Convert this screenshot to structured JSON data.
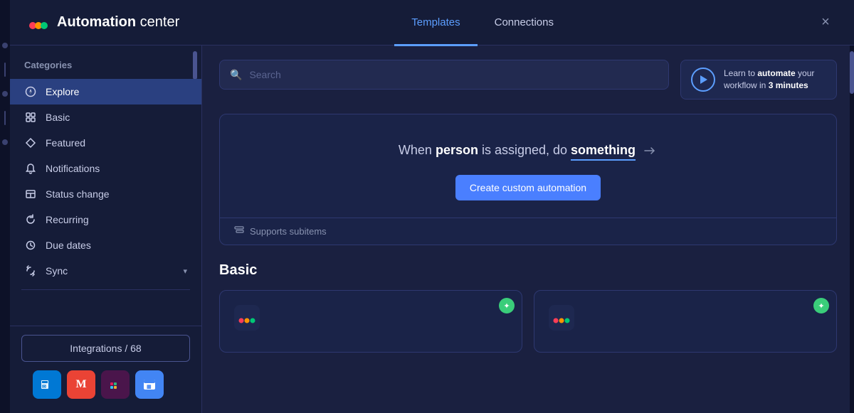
{
  "app": {
    "title_bold": "Automation",
    "title_normal": " center",
    "logo_colors": [
      "#ff3d57",
      "#ff9500",
      "#00c875"
    ]
  },
  "header": {
    "tabs": [
      {
        "id": "templates",
        "label": "Templates",
        "active": true
      },
      {
        "id": "connections",
        "label": "Connections",
        "active": false
      }
    ],
    "close_label": "×"
  },
  "sidebar": {
    "categories_label": "Categories",
    "scroll_indicator": true,
    "items": [
      {
        "id": "explore",
        "label": "Explore",
        "icon": "compass",
        "active": true
      },
      {
        "id": "basic",
        "label": "Basic",
        "icon": "grid"
      },
      {
        "id": "featured",
        "label": "Featured",
        "icon": "diamond"
      },
      {
        "id": "notifications",
        "label": "Notifications",
        "icon": "bell"
      },
      {
        "id": "status-change",
        "label": "Status change",
        "icon": "table"
      },
      {
        "id": "recurring",
        "label": "Recurring",
        "icon": "refresh"
      },
      {
        "id": "due-dates",
        "label": "Due dates",
        "icon": "clock"
      },
      {
        "id": "sync",
        "label": "Sync",
        "icon": "sync",
        "has_chevron": true
      }
    ],
    "integrations_btn": "Integrations / 68",
    "integration_icons": [
      {
        "id": "outlook",
        "symbol": "✉",
        "label": "Outlook"
      },
      {
        "id": "gmail",
        "symbol": "M",
        "label": "Gmail"
      },
      {
        "id": "slack",
        "symbol": "#",
        "label": "Slack"
      },
      {
        "id": "gcal",
        "symbol": "▦",
        "label": "Google Calendar"
      }
    ]
  },
  "search": {
    "placeholder": "Search"
  },
  "learn_card": {
    "text_1": "Learn to ",
    "text_bold": "automate",
    "text_2": " your",
    "text_3": "workflow in ",
    "text_time_bold": "3 minutes"
  },
  "custom_automation": {
    "sentence_pre": "When ",
    "trigger_word": "person",
    "sentence_mid": " is assigned, do ",
    "action_word": "something",
    "supports_subitems": "Supports subitems",
    "create_button": "Create custom automation"
  },
  "basic_section": {
    "heading": "Basic",
    "cards": [
      {
        "id": "card1",
        "has_sparkle": true
      },
      {
        "id": "card2",
        "has_sparkle": true
      }
    ]
  }
}
